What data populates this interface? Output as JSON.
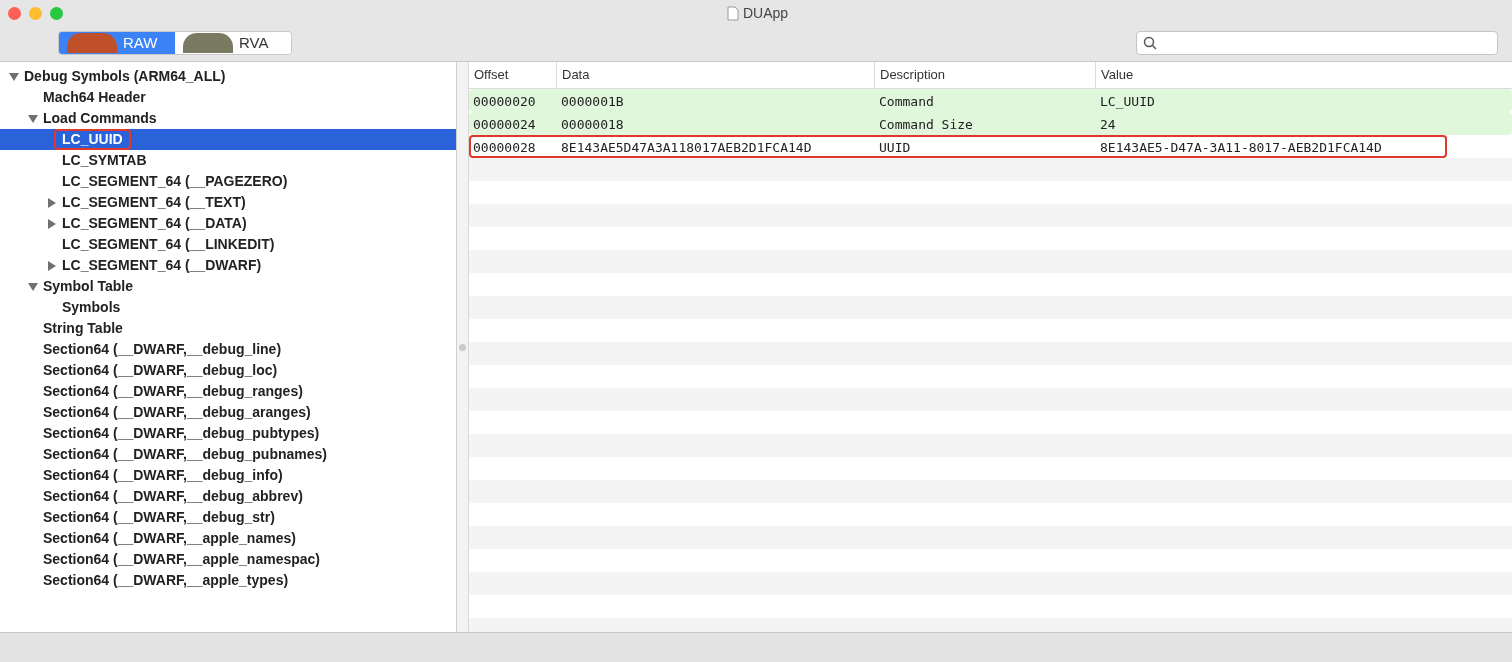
{
  "window": {
    "title": "DUApp"
  },
  "mode_toggle": [
    {
      "label": "RAW",
      "selected": true
    },
    {
      "label": "RVA",
      "selected": false
    }
  ],
  "tree": [
    {
      "label": "Debug Symbols (ARM64_ALL)",
      "expanded": true,
      "selected": false,
      "outlined": false,
      "children": [
        {
          "label": "Mach64 Header",
          "selected": false,
          "outlined": false
        },
        {
          "label": "Load Commands",
          "expanded": true,
          "selected": false,
          "outlined": false,
          "children": [
            {
              "label": "LC_UUID",
              "selected": true,
              "outlined": true
            },
            {
              "label": "LC_SYMTAB",
              "selected": false,
              "outlined": false
            },
            {
              "label": "LC_SEGMENT_64 (__PAGEZERO)",
              "selected": false,
              "outlined": false
            },
            {
              "label": "LC_SEGMENT_64 (__TEXT)",
              "expanded": false,
              "selected": false,
              "outlined": false
            },
            {
              "label": "LC_SEGMENT_64 (__DATA)",
              "expanded": false,
              "selected": false,
              "outlined": false
            },
            {
              "label": "LC_SEGMENT_64 (__LINKEDIT)",
              "selected": false,
              "outlined": false
            },
            {
              "label": "LC_SEGMENT_64 (__DWARF)",
              "expanded": false,
              "selected": false,
              "outlined": false
            }
          ]
        },
        {
          "label": "Symbol Table",
          "expanded": true,
          "selected": false,
          "outlined": false,
          "children": [
            {
              "label": "Symbols",
              "selected": false,
              "outlined": false
            }
          ]
        },
        {
          "label": "String Table",
          "selected": false,
          "outlined": false
        },
        {
          "label": "Section64 (__DWARF,__debug_line)",
          "selected": false,
          "outlined": false
        },
        {
          "label": "Section64 (__DWARF,__debug_loc)",
          "selected": false,
          "outlined": false
        },
        {
          "label": "Section64 (__DWARF,__debug_ranges)",
          "selected": false,
          "outlined": false
        },
        {
          "label": "Section64 (__DWARF,__debug_aranges)",
          "selected": false,
          "outlined": false
        },
        {
          "label": "Section64 (__DWARF,__debug_pubtypes)",
          "selected": false,
          "outlined": false
        },
        {
          "label": "Section64 (__DWARF,__debug_pubnames)",
          "selected": false,
          "outlined": false
        },
        {
          "label": "Section64 (__DWARF,__debug_info)",
          "selected": false,
          "outlined": false
        },
        {
          "label": "Section64 (__DWARF,__debug_abbrev)",
          "selected": false,
          "outlined": false
        },
        {
          "label": "Section64 (__DWARF,__debug_str)",
          "selected": false,
          "outlined": false
        },
        {
          "label": "Section64 (__DWARF,__apple_names)",
          "selected": false,
          "outlined": false
        },
        {
          "label": "Section64 (__DWARF,__apple_namespac)",
          "selected": false,
          "outlined": false
        },
        {
          "label": "Section64 (__DWARF,__apple_types)",
          "selected": false,
          "outlined": false
        }
      ]
    }
  ],
  "table": {
    "columns": [
      "Offset",
      "Data",
      "Description",
      "Value"
    ],
    "rows": [
      {
        "cells": [
          "00000020",
          "0000001B",
          "Command",
          "LC_UUID"
        ],
        "highlighted": true,
        "outlined": false
      },
      {
        "cells": [
          "00000024",
          "00000018",
          "Command Size",
          "24"
        ],
        "highlighted": true,
        "outlined": false
      },
      {
        "cells": [
          "00000028",
          "8E143AE5D47A3A118017AEB2D1FCA14D",
          "UUID",
          "8E143AE5-D47A-3A11-8017-AEB2D1FCA14D"
        ],
        "highlighted": false,
        "outlined": true
      }
    ]
  }
}
